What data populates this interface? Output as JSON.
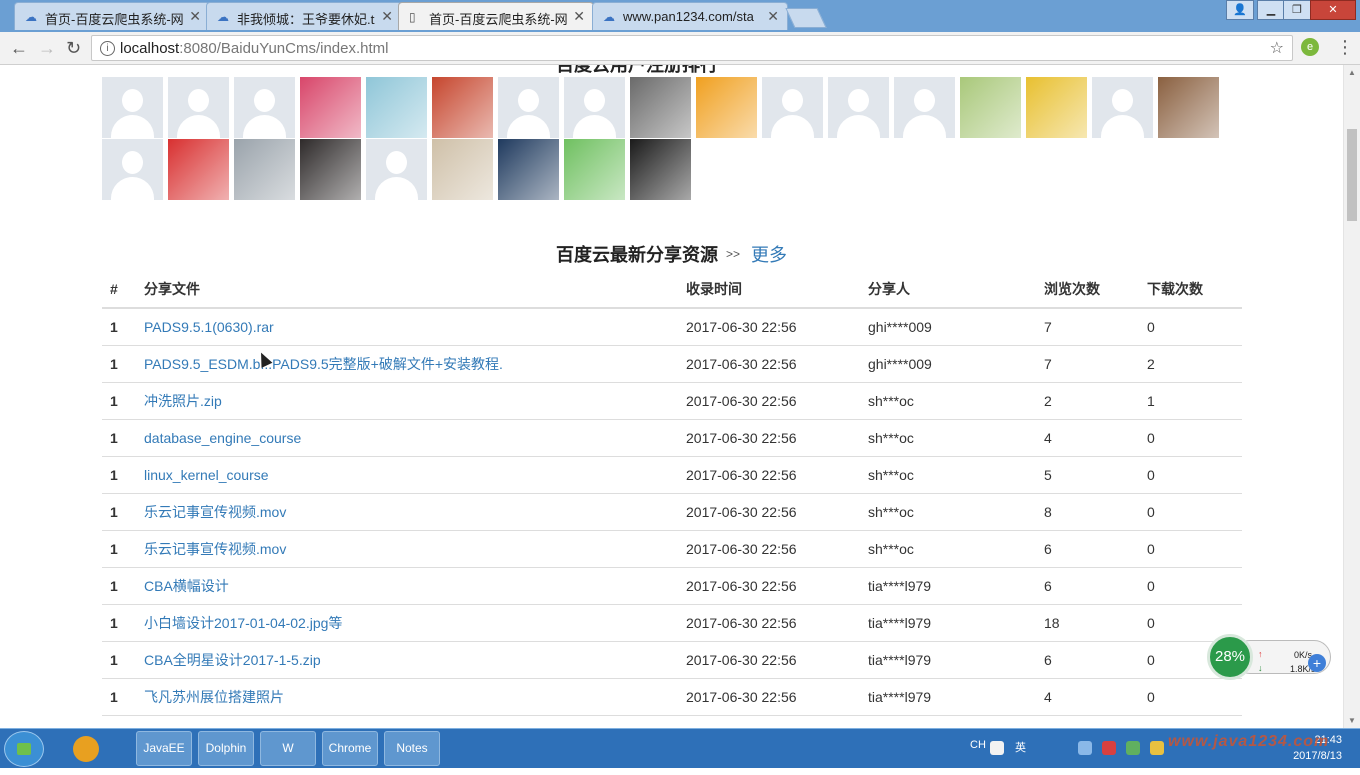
{
  "browser": {
    "tabs": [
      {
        "title": "首页-百度云爬虫系统-网",
        "active": false
      },
      {
        "title": "非我倾城：王爷要休妃.txt",
        "active": false
      },
      {
        "title": "首页-百度云爬虫系统-网",
        "active": true
      },
      {
        "title": "www.pan1234.com/sta",
        "active": false
      }
    ],
    "address_host": "localhost",
    "address_path": ":8080/BaiduYunCms/index.html"
  },
  "page": {
    "cut_section_title": "百度云用户注册排行",
    "avatars": [
      {
        "kind": "default"
      },
      {
        "kind": "default"
      },
      {
        "kind": "default"
      },
      {
        "kind": "photo",
        "color": "#d8466a"
      },
      {
        "kind": "photo",
        "color": "#8fc6d8"
      },
      {
        "kind": "photo",
        "color": "#c6462e"
      },
      {
        "kind": "default"
      },
      {
        "kind": "default"
      },
      {
        "kind": "photo",
        "color": "#6a6a6a"
      },
      {
        "kind": "photo",
        "color": "#f0a020"
      },
      {
        "kind": "default"
      },
      {
        "kind": "default"
      },
      {
        "kind": "default"
      },
      {
        "kind": "photo",
        "color": "#a9c87a"
      },
      {
        "kind": "photo",
        "color": "#e8c030"
      },
      {
        "kind": "default"
      },
      {
        "kind": "photo",
        "color": "#8a6040"
      },
      {
        "kind": "default"
      },
      {
        "kind": "photo",
        "color": "#d83030"
      },
      {
        "kind": "photo",
        "color": "#9aa3ab"
      },
      {
        "kind": "photo",
        "color": "#2e2a2a"
      },
      {
        "kind": "default"
      },
      {
        "kind": "photo",
        "color": "#cfc0a8"
      },
      {
        "kind": "photo",
        "color": "#1f3a5e"
      },
      {
        "kind": "photo",
        "color": "#6fc060"
      },
      {
        "kind": "photo",
        "color": "#1a1a1a"
      }
    ],
    "section_title": "百度云最新分享资源",
    "section_arrow": ">>",
    "more_link": "更多",
    "table": {
      "headers": [
        "#",
        "分享文件",
        "收录时间",
        "分享人",
        "浏览次数",
        "下载次数"
      ],
      "rows": [
        {
          "num": "1",
          "file": "PADS9.5.1(0630).rar",
          "time": "2017-06-30 22:56",
          "sharer": "ghi****009",
          "views": "7",
          "downloads": "0"
        },
        {
          "num": "1",
          "file": "PADS9.5_ESDM.b...PADS9.5完整版+破解文件+安装教程.",
          "time": "2017-06-30 22:56",
          "sharer": "ghi****009",
          "views": "7",
          "downloads": "2"
        },
        {
          "num": "1",
          "file": "冲洗照片.zip",
          "time": "2017-06-30 22:56",
          "sharer": "sh***oc",
          "views": "2",
          "downloads": "1"
        },
        {
          "num": "1",
          "file": "database_engine_course",
          "time": "2017-06-30 22:56",
          "sharer": "sh***oc",
          "views": "4",
          "downloads": "0"
        },
        {
          "num": "1",
          "file": "linux_kernel_course",
          "time": "2017-06-30 22:56",
          "sharer": "sh***oc",
          "views": "5",
          "downloads": "0"
        },
        {
          "num": "1",
          "file": "乐云记事宣传视频.mov",
          "time": "2017-06-30 22:56",
          "sharer": "sh***oc",
          "views": "8",
          "downloads": "0"
        },
        {
          "num": "1",
          "file": "乐云记事宣传视频.mov",
          "time": "2017-06-30 22:56",
          "sharer": "sh***oc",
          "views": "6",
          "downloads": "0"
        },
        {
          "num": "1",
          "file": "CBA横幅设计",
          "time": "2017-06-30 22:56",
          "sharer": "tia****l979",
          "views": "6",
          "downloads": "0"
        },
        {
          "num": "1",
          "file": "小白墙设计2017-01-04-02.jpg等",
          "time": "2017-06-30 22:56",
          "sharer": "tia****l979",
          "views": "18",
          "downloads": "0"
        },
        {
          "num": "1",
          "file": "CBA全明星设计2017-1-5.zip",
          "time": "2017-06-30 22:56",
          "sharer": "tia****l979",
          "views": "6",
          "downloads": "0"
        },
        {
          "num": "1",
          "file": "飞凡苏州展位搭建照片",
          "time": "2017-06-30 22:56",
          "sharer": "tia****l979",
          "views": "4",
          "downloads": "0"
        }
      ]
    }
  },
  "net_widget": {
    "percent": "28%",
    "up": "0K/s",
    "down": "1.8K/s"
  },
  "taskbar": {
    "apps": [
      "JavaEE",
      "Dolphin",
      "W",
      "Chrome",
      "Notes"
    ],
    "tray_lang": "CH",
    "tray_ime": "英",
    "clock_time": "21:43",
    "clock_date": "2017/8/13",
    "watermark": "www.java1234.com"
  }
}
